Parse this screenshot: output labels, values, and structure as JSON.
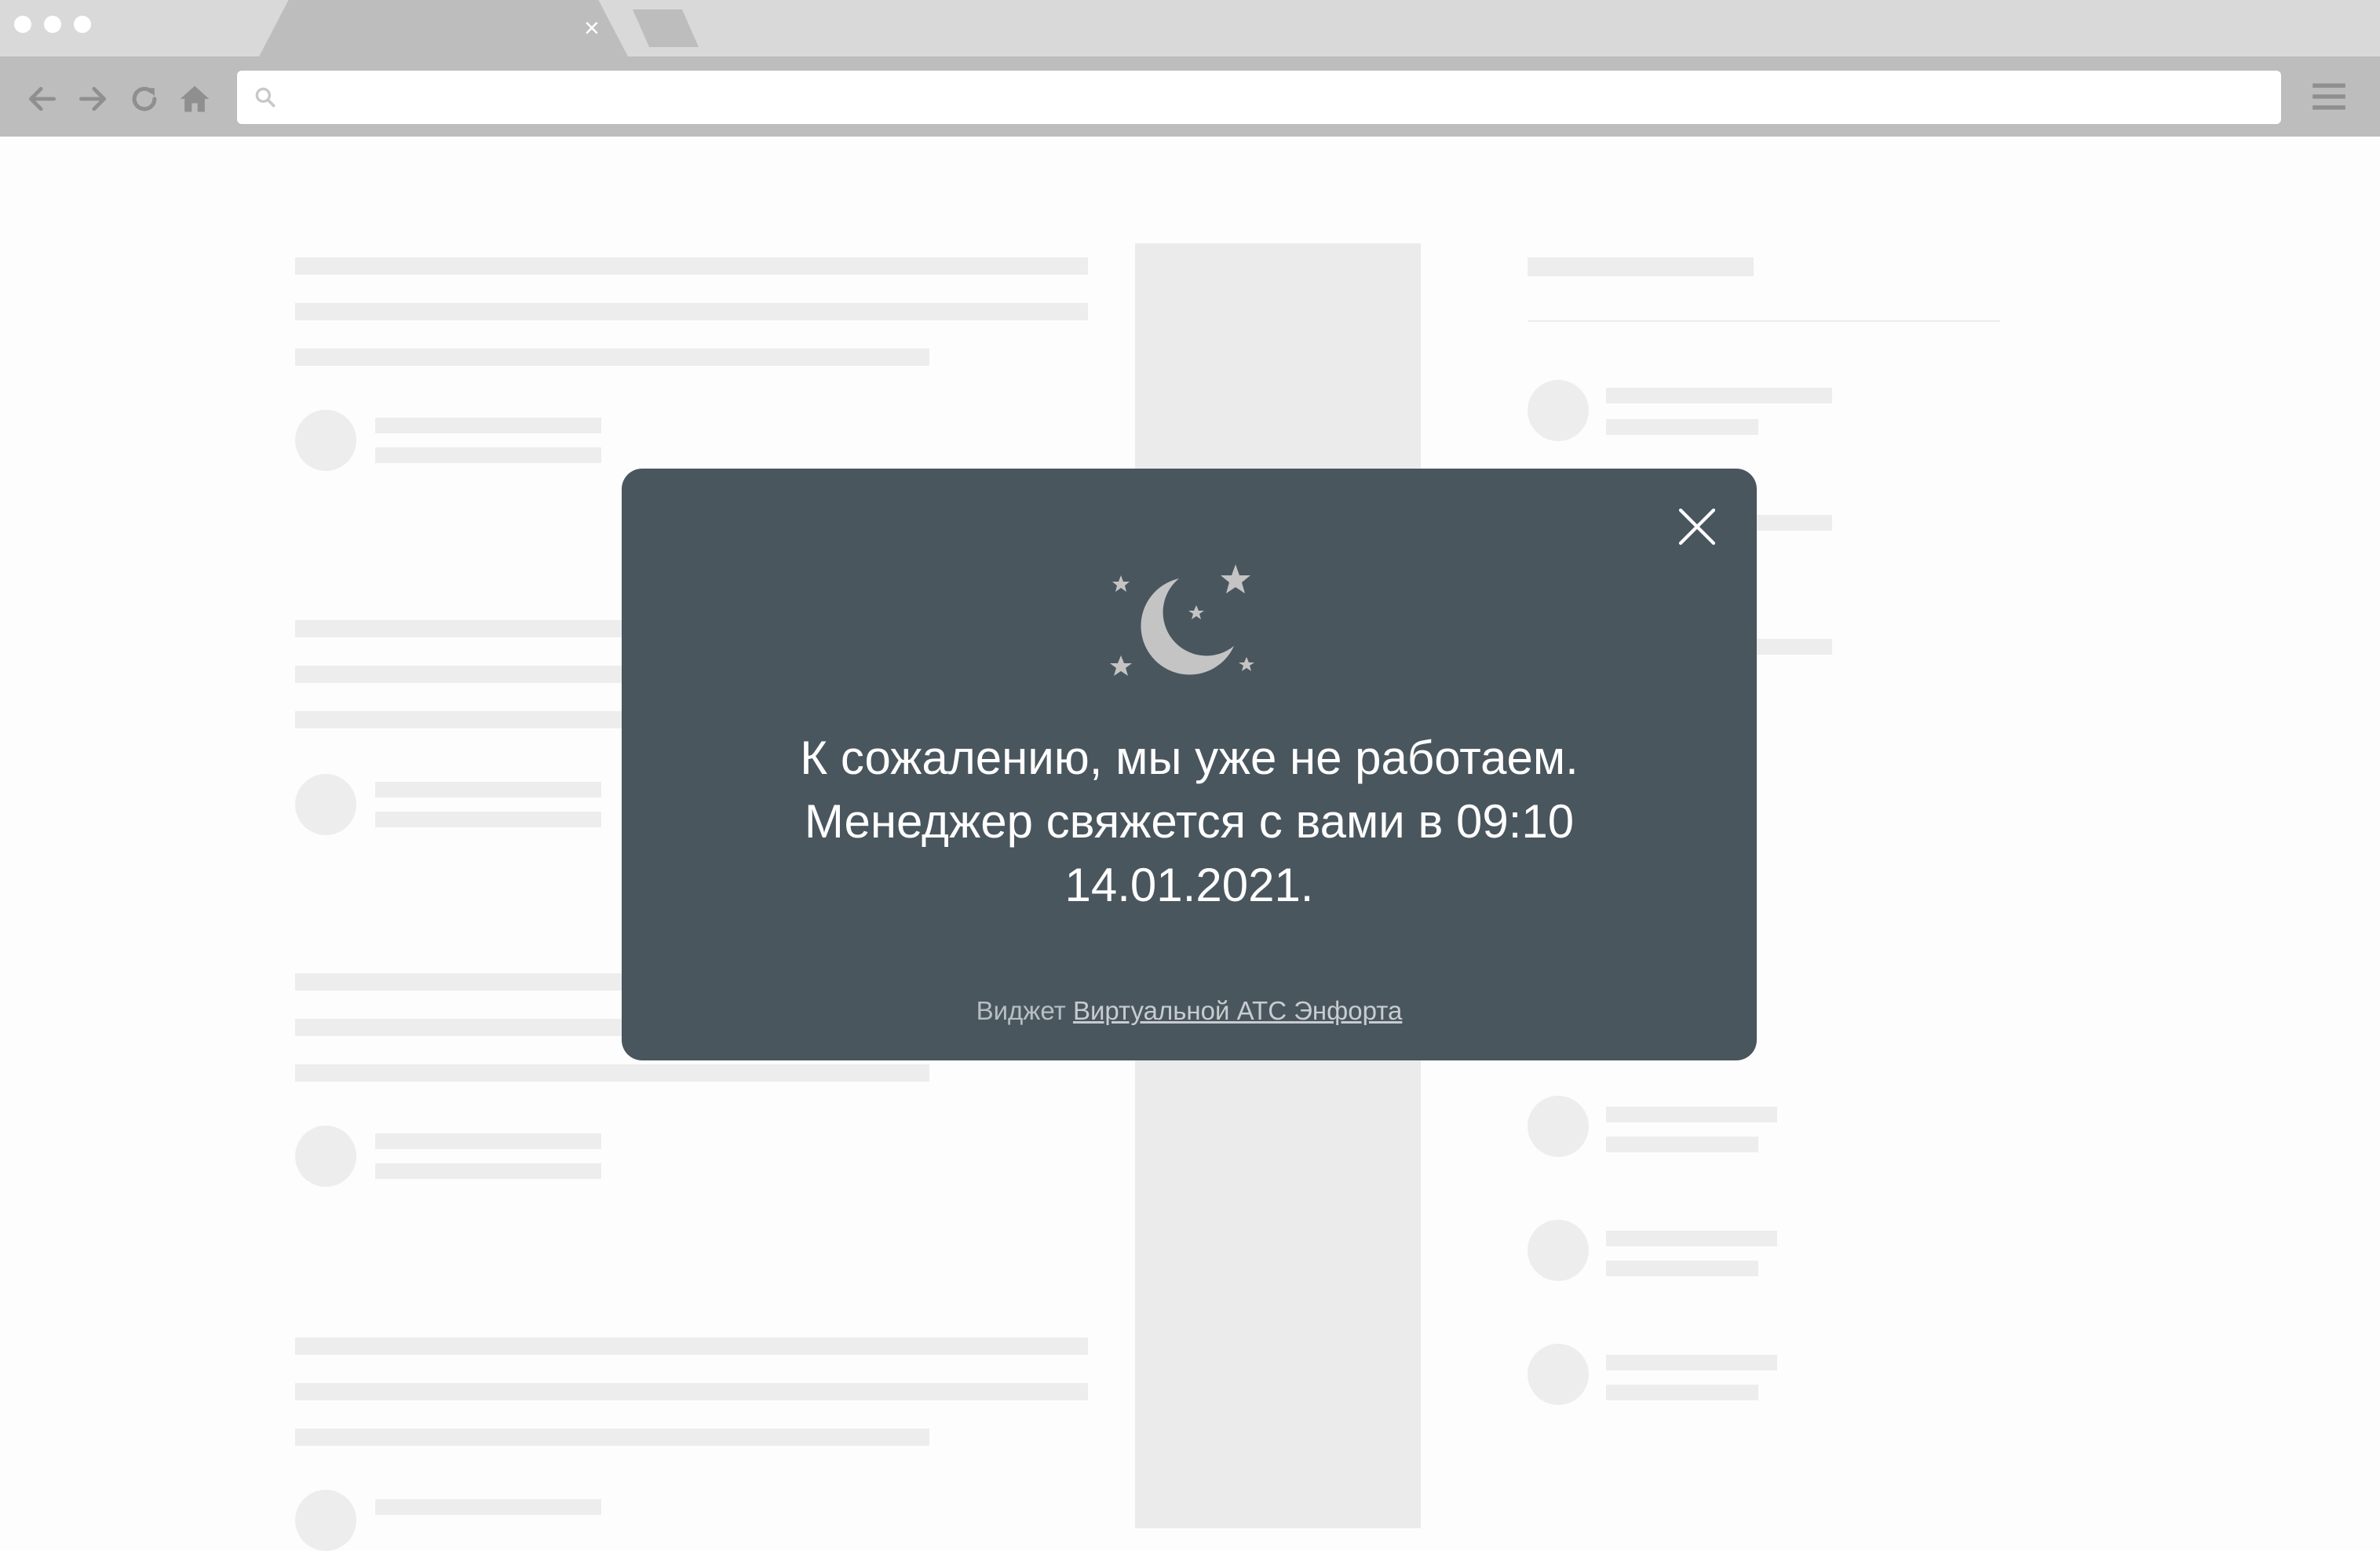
{
  "browser": {
    "tab_close_glyph": "×",
    "address_bar": {
      "value": "",
      "placeholder": ""
    }
  },
  "modal": {
    "line1": "К сожалению, мы уже не работаем.",
    "line2": "Менеджер свяжется с вами в 09:10",
    "line3": "14.01.2021.",
    "footer_prefix": "Виджет ",
    "footer_link": "Виртуальной АТС Энфорта",
    "icon": "moon-stars-icon",
    "close_icon": "close-icon"
  },
  "colors": {
    "modal_background": "#4a565e",
    "moon": "#c4c4c4",
    "chrome_dark": "#bdbdbd",
    "chrome_light": "#d9d9d9"
  }
}
